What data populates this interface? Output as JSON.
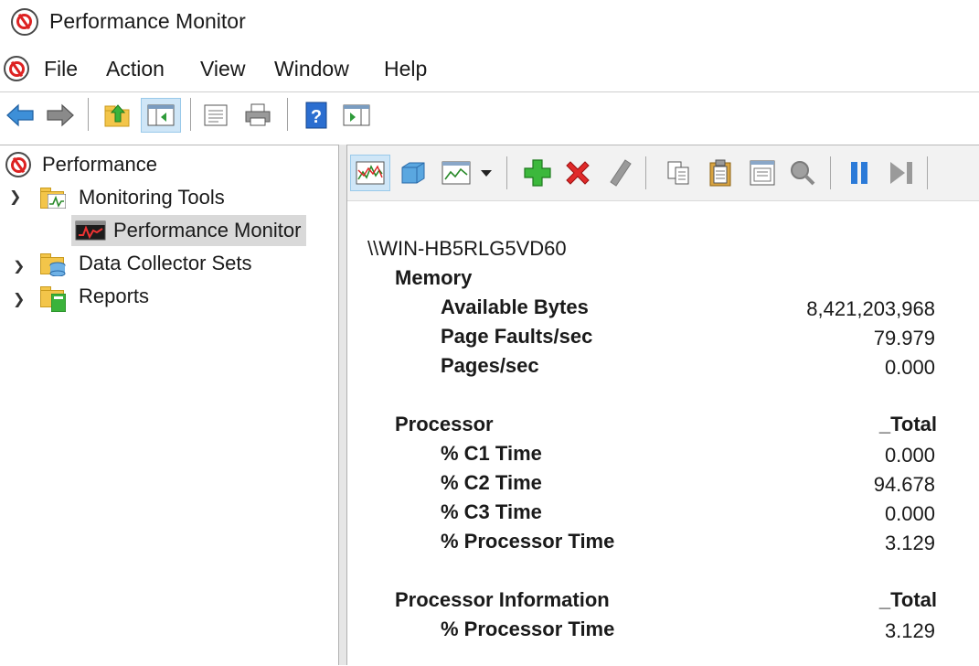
{
  "window": {
    "title": "Performance Monitor"
  },
  "menu": [
    {
      "id": "file",
      "label": "File"
    },
    {
      "id": "action",
      "label": "Action"
    },
    {
      "id": "view",
      "label": "View"
    },
    {
      "id": "window",
      "label": "Window"
    },
    {
      "id": "help",
      "label": "Help"
    }
  ],
  "toolbar": {
    "icons": [
      "back-arrow-icon",
      "forward-arrow-icon",
      "up-folder-icon",
      "show-hide-console-tree-icon",
      "properties-icon",
      "print-icon",
      "help-icon",
      "show-action-pane-icon"
    ]
  },
  "tree": {
    "root": "Performance",
    "monitoring_tools": "Monitoring Tools",
    "performance_monitor": "Performance Monitor",
    "data_collector_sets": "Data Collector Sets",
    "reports": "Reports"
  },
  "graph_toolbar": {
    "icons": [
      "view-current-activity-icon",
      "view-log-data-icon",
      "change-graph-type-icon",
      "dropdown-arrow-icon",
      "add-counter-icon",
      "delete-counter-icon",
      "highlight-icon",
      "copy-properties-icon",
      "paste-counter-list-icon",
      "properties-icon",
      "zoom-icon",
      "freeze-display-icon",
      "update-data-icon"
    ]
  },
  "report": {
    "machine": "\\\\WIN-HB5RLG5VD60",
    "memory": {
      "label": "Memory",
      "counters": [
        {
          "name": "Available Bytes",
          "value": "8,421,203,968"
        },
        {
          "name": "Page Faults/sec",
          "value": "79.979"
        },
        {
          "name": "Pages/sec",
          "value": "0.000"
        }
      ]
    },
    "processor": {
      "label": "Processor",
      "instance": "_Total",
      "counters": [
        {
          "name": "% C1 Time",
          "value": "0.000"
        },
        {
          "name": "% C2 Time",
          "value": "94.678"
        },
        {
          "name": "% C3 Time",
          "value": "0.000"
        },
        {
          "name": "% Processor Time",
          "value": "3.129"
        }
      ]
    },
    "processor_information": {
      "label": "Processor Information",
      "instance": "_Total",
      "counters": [
        {
          "name": "% Processor Time",
          "value": "3.129"
        }
      ]
    }
  },
  "colors": {
    "accent_select": "#cfe6f7",
    "tree_selected": "#d9d9d9",
    "brand_red": "#dd2222"
  }
}
